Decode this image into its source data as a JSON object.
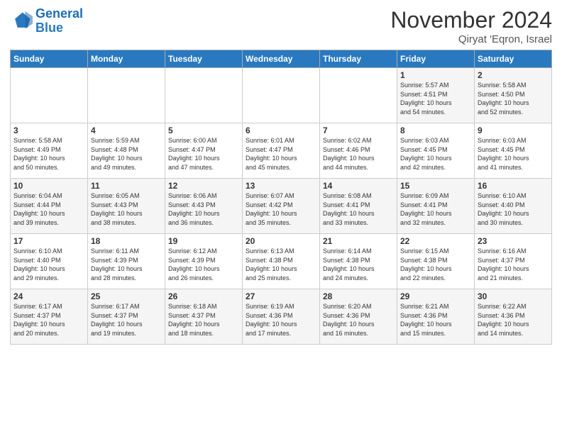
{
  "header": {
    "logo_line1": "General",
    "logo_line2": "Blue",
    "month": "November 2024",
    "location": "Qiryat 'Eqron, Israel"
  },
  "days_of_week": [
    "Sunday",
    "Monday",
    "Tuesday",
    "Wednesday",
    "Thursday",
    "Friday",
    "Saturday"
  ],
  "weeks": [
    [
      {
        "day": "",
        "detail": ""
      },
      {
        "day": "",
        "detail": ""
      },
      {
        "day": "",
        "detail": ""
      },
      {
        "day": "",
        "detail": ""
      },
      {
        "day": "",
        "detail": ""
      },
      {
        "day": "1",
        "detail": "Sunrise: 5:57 AM\nSunset: 4:51 PM\nDaylight: 10 hours\nand 54 minutes."
      },
      {
        "day": "2",
        "detail": "Sunrise: 5:58 AM\nSunset: 4:50 PM\nDaylight: 10 hours\nand 52 minutes."
      }
    ],
    [
      {
        "day": "3",
        "detail": "Sunrise: 5:58 AM\nSunset: 4:49 PM\nDaylight: 10 hours\nand 50 minutes."
      },
      {
        "day": "4",
        "detail": "Sunrise: 5:59 AM\nSunset: 4:48 PM\nDaylight: 10 hours\nand 49 minutes."
      },
      {
        "day": "5",
        "detail": "Sunrise: 6:00 AM\nSunset: 4:47 PM\nDaylight: 10 hours\nand 47 minutes."
      },
      {
        "day": "6",
        "detail": "Sunrise: 6:01 AM\nSunset: 4:47 PM\nDaylight: 10 hours\nand 45 minutes."
      },
      {
        "day": "7",
        "detail": "Sunrise: 6:02 AM\nSunset: 4:46 PM\nDaylight: 10 hours\nand 44 minutes."
      },
      {
        "day": "8",
        "detail": "Sunrise: 6:03 AM\nSunset: 4:45 PM\nDaylight: 10 hours\nand 42 minutes."
      },
      {
        "day": "9",
        "detail": "Sunrise: 6:03 AM\nSunset: 4:45 PM\nDaylight: 10 hours\nand 41 minutes."
      }
    ],
    [
      {
        "day": "10",
        "detail": "Sunrise: 6:04 AM\nSunset: 4:44 PM\nDaylight: 10 hours\nand 39 minutes."
      },
      {
        "day": "11",
        "detail": "Sunrise: 6:05 AM\nSunset: 4:43 PM\nDaylight: 10 hours\nand 38 minutes."
      },
      {
        "day": "12",
        "detail": "Sunrise: 6:06 AM\nSunset: 4:43 PM\nDaylight: 10 hours\nand 36 minutes."
      },
      {
        "day": "13",
        "detail": "Sunrise: 6:07 AM\nSunset: 4:42 PM\nDaylight: 10 hours\nand 35 minutes."
      },
      {
        "day": "14",
        "detail": "Sunrise: 6:08 AM\nSunset: 4:41 PM\nDaylight: 10 hours\nand 33 minutes."
      },
      {
        "day": "15",
        "detail": "Sunrise: 6:09 AM\nSunset: 4:41 PM\nDaylight: 10 hours\nand 32 minutes."
      },
      {
        "day": "16",
        "detail": "Sunrise: 6:10 AM\nSunset: 4:40 PM\nDaylight: 10 hours\nand 30 minutes."
      }
    ],
    [
      {
        "day": "17",
        "detail": "Sunrise: 6:10 AM\nSunset: 4:40 PM\nDaylight: 10 hours\nand 29 minutes."
      },
      {
        "day": "18",
        "detail": "Sunrise: 6:11 AM\nSunset: 4:39 PM\nDaylight: 10 hours\nand 28 minutes."
      },
      {
        "day": "19",
        "detail": "Sunrise: 6:12 AM\nSunset: 4:39 PM\nDaylight: 10 hours\nand 26 minutes."
      },
      {
        "day": "20",
        "detail": "Sunrise: 6:13 AM\nSunset: 4:38 PM\nDaylight: 10 hours\nand 25 minutes."
      },
      {
        "day": "21",
        "detail": "Sunrise: 6:14 AM\nSunset: 4:38 PM\nDaylight: 10 hours\nand 24 minutes."
      },
      {
        "day": "22",
        "detail": "Sunrise: 6:15 AM\nSunset: 4:38 PM\nDaylight: 10 hours\nand 22 minutes."
      },
      {
        "day": "23",
        "detail": "Sunrise: 6:16 AM\nSunset: 4:37 PM\nDaylight: 10 hours\nand 21 minutes."
      }
    ],
    [
      {
        "day": "24",
        "detail": "Sunrise: 6:17 AM\nSunset: 4:37 PM\nDaylight: 10 hours\nand 20 minutes."
      },
      {
        "day": "25",
        "detail": "Sunrise: 6:17 AM\nSunset: 4:37 PM\nDaylight: 10 hours\nand 19 minutes."
      },
      {
        "day": "26",
        "detail": "Sunrise: 6:18 AM\nSunset: 4:37 PM\nDaylight: 10 hours\nand 18 minutes."
      },
      {
        "day": "27",
        "detail": "Sunrise: 6:19 AM\nSunset: 4:36 PM\nDaylight: 10 hours\nand 17 minutes."
      },
      {
        "day": "28",
        "detail": "Sunrise: 6:20 AM\nSunset: 4:36 PM\nDaylight: 10 hours\nand 16 minutes."
      },
      {
        "day": "29",
        "detail": "Sunrise: 6:21 AM\nSunset: 4:36 PM\nDaylight: 10 hours\nand 15 minutes."
      },
      {
        "day": "30",
        "detail": "Sunrise: 6:22 AM\nSunset: 4:36 PM\nDaylight: 10 hours\nand 14 minutes."
      }
    ]
  ]
}
